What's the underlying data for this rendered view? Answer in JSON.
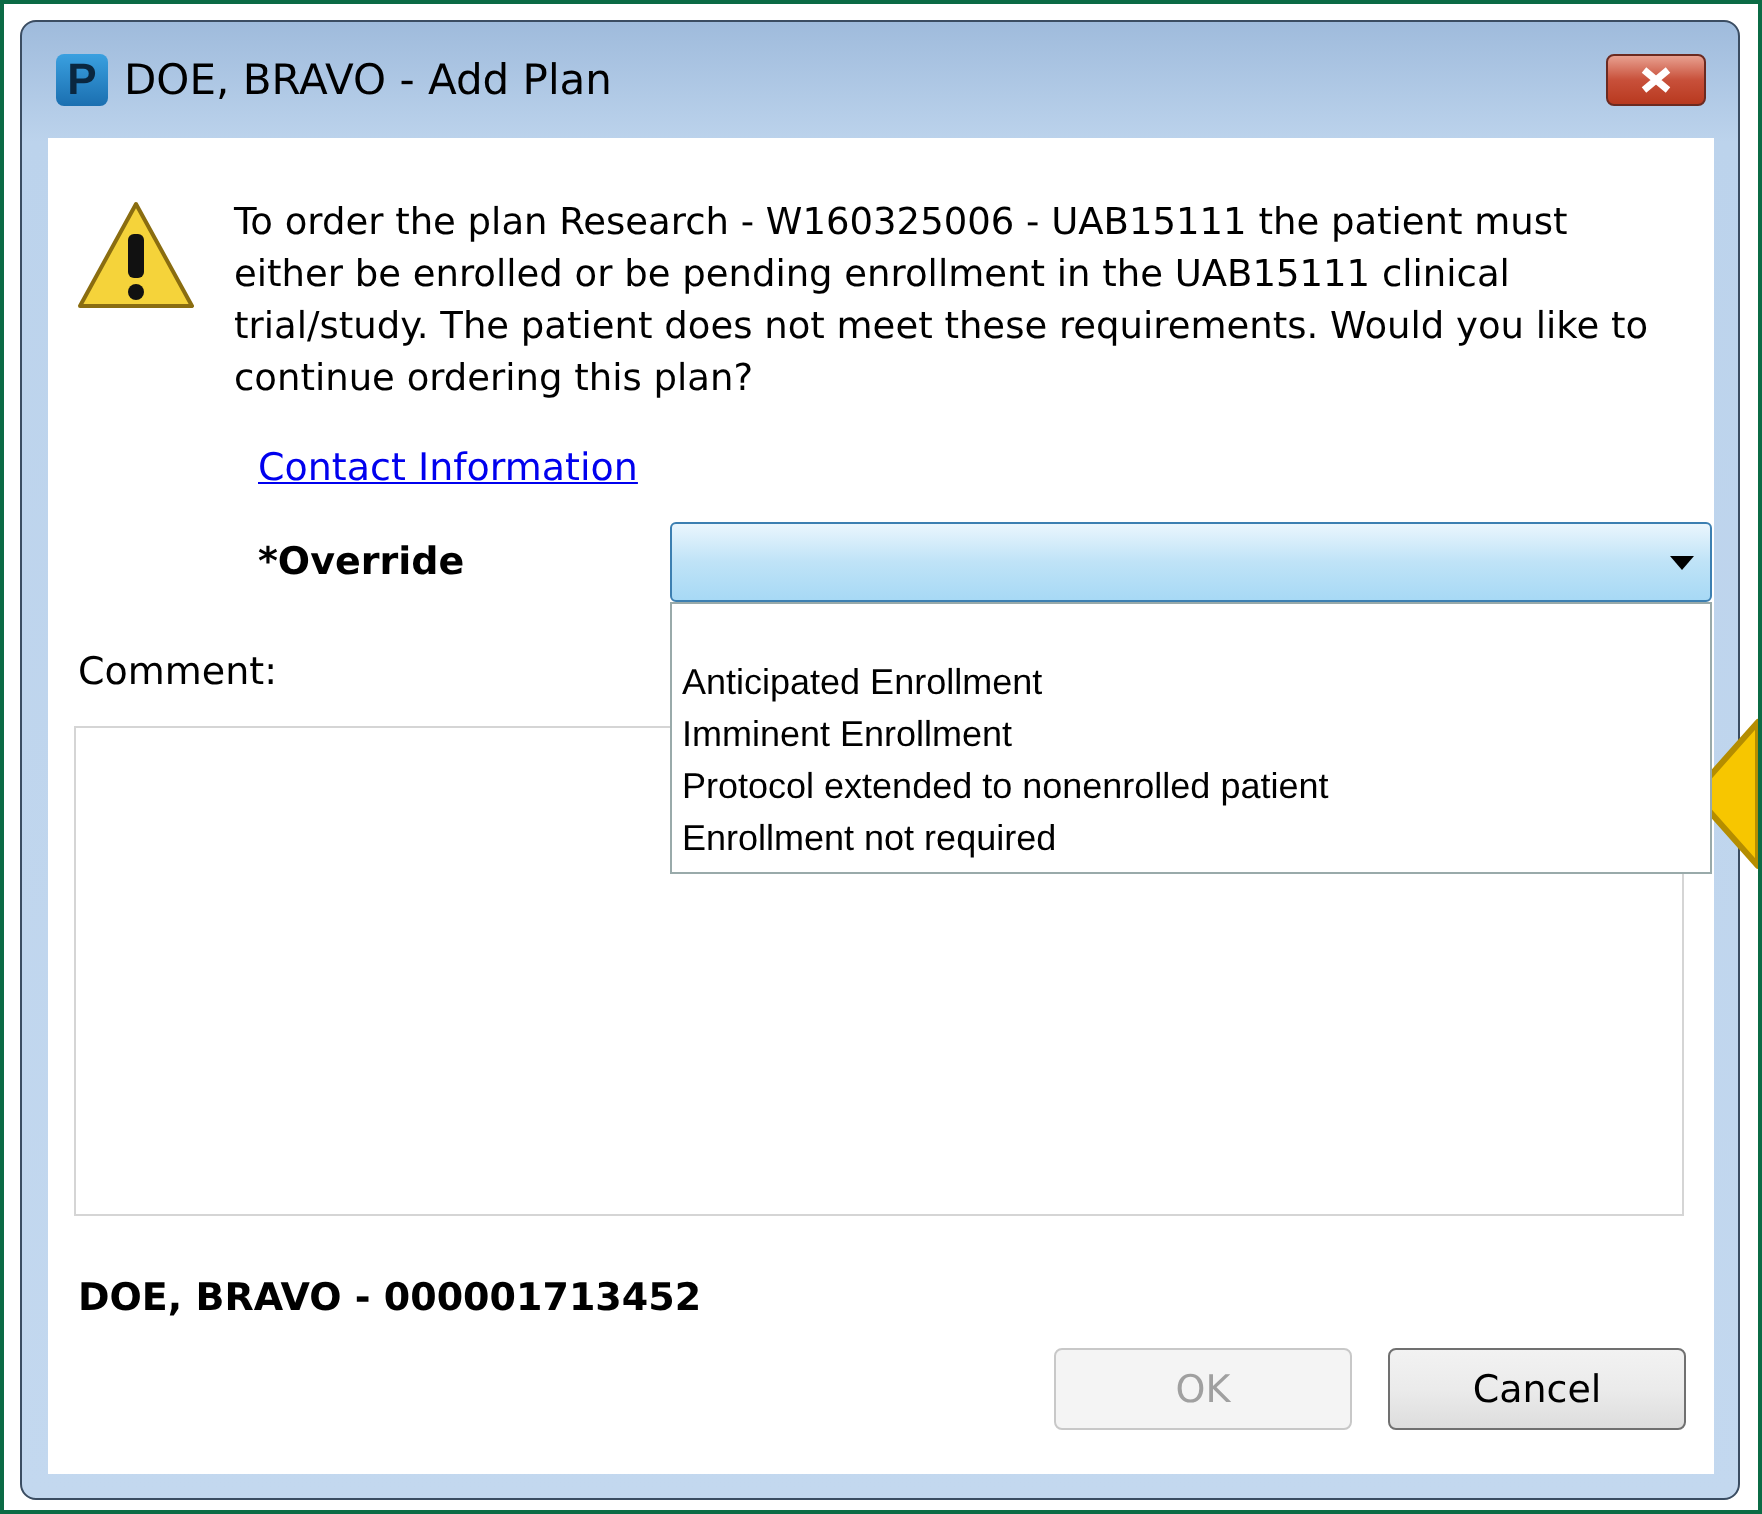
{
  "window": {
    "title": "DOE, BRAVO - Add Plan",
    "app_icon_letter": "P"
  },
  "message": "To order the plan Research - W160325006 - UAB15111 the patient must either be enrolled or be pending enrollment in the UAB15111 clinical trial/study. The patient does not meet these requirements. Would you like to continue ordering this plan?",
  "link": "Contact Information",
  "override": {
    "label": "*Override",
    "expanded": true,
    "options": [
      {
        "label": "Anticipated Enrollment",
        "selected": false
      },
      {
        "label": "Imminent Enrollment",
        "selected": false
      },
      {
        "label": "Protocol extended to nonenrolled patient",
        "selected": false
      },
      {
        "label": "Enrollment not required",
        "selected": false
      }
    ]
  },
  "comment": {
    "label": "Comment:"
  },
  "patient": "DOE, BRAVO - 000001713452",
  "buttons": [
    {
      "label": "OK",
      "disabled": true
    },
    {
      "label": "Cancel",
      "disabled": false
    }
  ]
}
